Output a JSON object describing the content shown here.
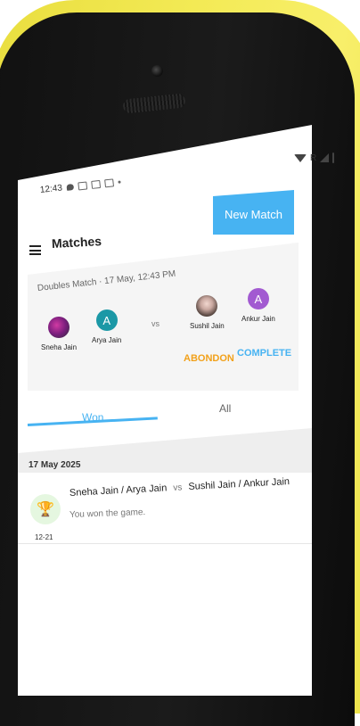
{
  "status_bar": {
    "time": "12:43",
    "indicator": "R"
  },
  "header": {
    "title": "Matches",
    "new_match_label": "New Match"
  },
  "match_card": {
    "header": "Doubles Match · 17 May, 12:43 PM",
    "team_a": [
      {
        "name": "Sneha Jain",
        "initial": ""
      },
      {
        "name": "Arya Jain",
        "initial": "A"
      }
    ],
    "vs": "vs",
    "team_b": [
      {
        "name": "Sushil Jain",
        "initial": ""
      },
      {
        "name": "Ankur Jain",
        "initial": "A"
      }
    ],
    "actions": {
      "abandon": "ABONDON",
      "complete": "COMPLETE"
    }
  },
  "tabs": [
    {
      "label": "Won"
    },
    {
      "label": "All"
    }
  ],
  "list": {
    "date": "17 May 2025",
    "items": [
      {
        "team_a": "Sneha Jain / Arya Jain",
        "vs": "vs",
        "team_b": "Sushil Jain / Ankur Jain",
        "result": "You won the game.",
        "score": "12-21",
        "icon": "trophy-icon"
      }
    ]
  },
  "colors": {
    "accent": "#47b3f2",
    "warning": "#f2a11a",
    "phone": "#f3ea55"
  }
}
